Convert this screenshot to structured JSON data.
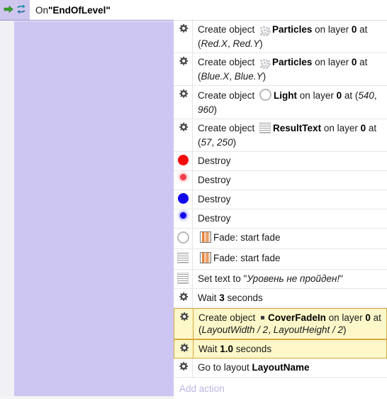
{
  "condition": {
    "arrow_icon": "right-arrow-icon",
    "loop_icon": "loop-arrows-icon",
    "prefix": "On ",
    "trigger_name": "\"EndOfLevel\""
  },
  "add_action_label": "Add action",
  "colors": {
    "event_block": "#cdc6f2",
    "header_gutter": "#cfc6ee",
    "selected_row_bg": "#fdf7c9",
    "selected_row_border": "#d8a93f",
    "add_action_text": "#bfb4e6",
    "red_object": "#f50a0a",
    "blue_object": "#1106f0"
  },
  "actions": [
    {
      "icon": "gear-icon",
      "selected": false,
      "parts": [
        {
          "t": "Create object ",
          "s": "plain"
        },
        {
          "t": "",
          "s": "icon-particles"
        },
        {
          "t": "Particles",
          "s": "bold"
        },
        {
          "t": " on layer ",
          "s": "plain"
        },
        {
          "t": "0",
          "s": "bold"
        },
        {
          "t": " at (",
          "s": "plain"
        },
        {
          "t": "Red.X",
          "s": "italic"
        },
        {
          "t": ", ",
          "s": "plain"
        },
        {
          "t": "Red.Y",
          "s": "italic"
        },
        {
          "t": ")",
          "s": "plain"
        }
      ]
    },
    {
      "icon": "gear-icon",
      "selected": false,
      "parts": [
        {
          "t": "Create object ",
          "s": "plain"
        },
        {
          "t": "",
          "s": "icon-particles"
        },
        {
          "t": "Particles",
          "s": "bold"
        },
        {
          "t": " on layer ",
          "s": "plain"
        },
        {
          "t": "0",
          "s": "bold"
        },
        {
          "t": " at (",
          "s": "plain"
        },
        {
          "t": "Blue.X",
          "s": "italic"
        },
        {
          "t": ", ",
          "s": "plain"
        },
        {
          "t": "Blue.Y",
          "s": "italic"
        },
        {
          "t": ")",
          "s": "plain"
        }
      ]
    },
    {
      "icon": "gear-icon",
      "selected": false,
      "parts": [
        {
          "t": "Create object ",
          "s": "plain"
        },
        {
          "t": "",
          "s": "icon-ring"
        },
        {
          "t": "Light",
          "s": "bold"
        },
        {
          "t": " on layer ",
          "s": "plain"
        },
        {
          "t": "0",
          "s": "bold"
        },
        {
          "t": " at (",
          "s": "plain"
        },
        {
          "t": "540",
          "s": "italic"
        },
        {
          "t": ", ",
          "s": "plain"
        },
        {
          "t": "960",
          "s": "italic"
        },
        {
          "t": ")",
          "s": "plain"
        }
      ]
    },
    {
      "icon": "gear-icon",
      "selected": false,
      "parts": [
        {
          "t": "Create object ",
          "s": "plain"
        },
        {
          "t": "",
          "s": "icon-text"
        },
        {
          "t": "ResultText",
          "s": "bold"
        },
        {
          "t": " on layer ",
          "s": "plain"
        },
        {
          "t": "0",
          "s": "bold"
        },
        {
          "t": " at (",
          "s": "plain"
        },
        {
          "t": "57",
          "s": "italic"
        },
        {
          "t": ", ",
          "s": "plain"
        },
        {
          "t": "250",
          "s": "italic"
        },
        {
          "t": ")",
          "s": "plain"
        }
      ]
    },
    {
      "icon": "red-circle-large-icon",
      "selected": false,
      "parts": [
        {
          "t": "Destroy",
          "s": "plain"
        }
      ]
    },
    {
      "icon": "red-circle-small-icon",
      "selected": false,
      "parts": [
        {
          "t": "Destroy",
          "s": "plain"
        }
      ]
    },
    {
      "icon": "blue-circle-large-icon",
      "selected": false,
      "parts": [
        {
          "t": "Destroy",
          "s": "plain"
        }
      ]
    },
    {
      "icon": "blue-circle-small-icon",
      "selected": false,
      "parts": [
        {
          "t": "Destroy",
          "s": "plain"
        }
      ]
    },
    {
      "icon": "ring-icon",
      "selected": false,
      "parts": [
        {
          "t": "",
          "s": "icon-fade"
        },
        {
          "t": "Fade: start fade",
          "s": "plain"
        }
      ]
    },
    {
      "icon": "text-object-icon",
      "selected": false,
      "parts": [
        {
          "t": "",
          "s": "icon-fade"
        },
        {
          "t": "Fade: start fade",
          "s": "plain"
        }
      ]
    },
    {
      "icon": "text-object-icon",
      "selected": false,
      "parts": [
        {
          "t": "Set text to \"",
          "s": "plain"
        },
        {
          "t": "Уровень не пройден!",
          "s": "italic"
        },
        {
          "t": "\"",
          "s": "plain"
        }
      ]
    },
    {
      "icon": "gear-icon",
      "selected": false,
      "parts": [
        {
          "t": "Wait ",
          "s": "plain"
        },
        {
          "t": "3",
          "s": "bold"
        },
        {
          "t": " seconds",
          "s": "plain"
        }
      ]
    },
    {
      "icon": "gear-icon",
      "selected": true,
      "parts": [
        {
          "t": "Create object ",
          "s": "plain"
        },
        {
          "t": "",
          "s": "icon-square"
        },
        {
          "t": "CoverFadeIn",
          "s": "bold"
        },
        {
          "t": " on layer ",
          "s": "plain"
        },
        {
          "t": "0",
          "s": "bold"
        },
        {
          "t": " at (",
          "s": "plain"
        },
        {
          "t": "LayoutWidth / 2",
          "s": "italic"
        },
        {
          "t": ", ",
          "s": "plain"
        },
        {
          "t": "LayoutHeight / 2",
          "s": "italic"
        },
        {
          "t": ")",
          "s": "plain"
        }
      ]
    },
    {
      "icon": "gear-icon",
      "selected": true,
      "parts": [
        {
          "t": "Wait ",
          "s": "plain"
        },
        {
          "t": "1.0",
          "s": "bold"
        },
        {
          "t": " seconds",
          "s": "plain"
        }
      ]
    },
    {
      "icon": "gear-icon",
      "selected": false,
      "parts": [
        {
          "t": "Go to layout ",
          "s": "plain"
        },
        {
          "t": "LayoutName",
          "s": "bold"
        }
      ]
    }
  ]
}
